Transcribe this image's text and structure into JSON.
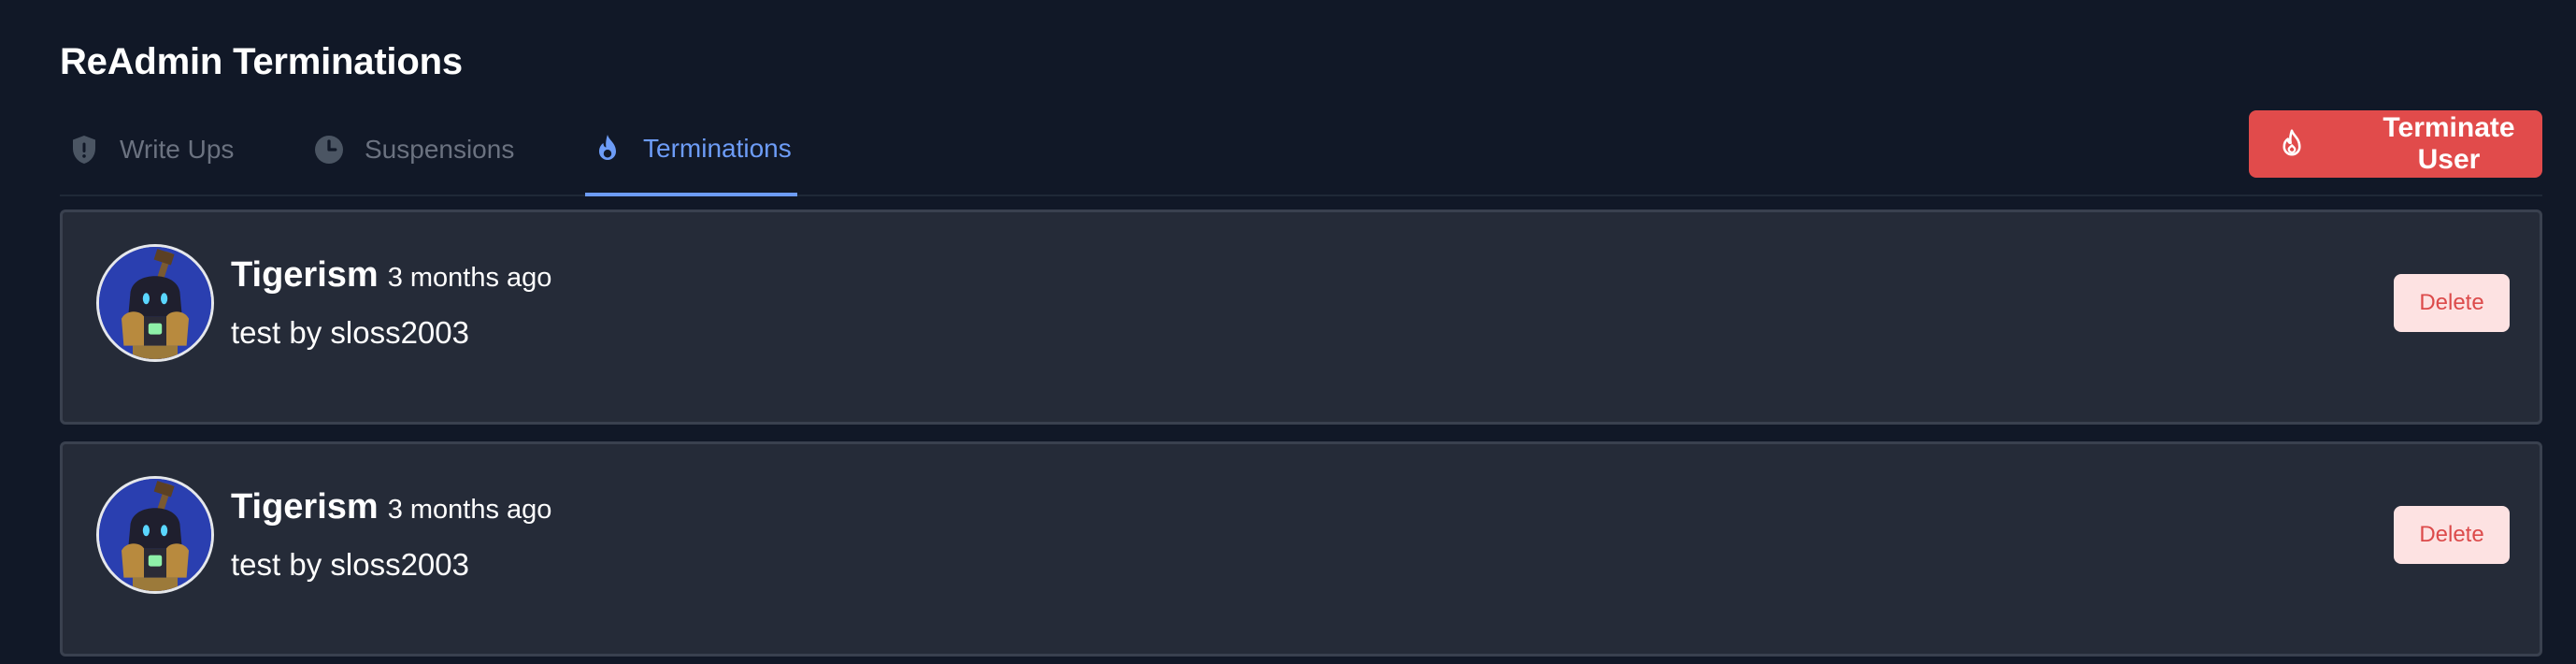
{
  "header": {
    "title": "ReAdmin Terminations"
  },
  "tabs": [
    {
      "label": "Write Ups",
      "icon": "shield-icon",
      "active": false
    },
    {
      "label": "Suspensions",
      "icon": "clock-icon",
      "active": false
    },
    {
      "label": "Terminations",
      "icon": "fire-icon",
      "active": true
    }
  ],
  "actions": {
    "terminate_label": "Terminate User",
    "terminate_icon": "fire-icon"
  },
  "colors": {
    "background": "#111827",
    "card": "#252b38",
    "accent": "#6d9cf7",
    "danger": "#e14b4b",
    "delete_bg": "#fde2e2",
    "delete_text": "#dc4a4a"
  },
  "terminations": [
    {
      "name": "Tigerism",
      "time": "3 months ago",
      "reason": "test by sloss2003",
      "delete_label": "Delete"
    },
    {
      "name": "Tigerism",
      "time": "3 months ago",
      "reason": "test by sloss2003",
      "delete_label": "Delete"
    }
  ]
}
